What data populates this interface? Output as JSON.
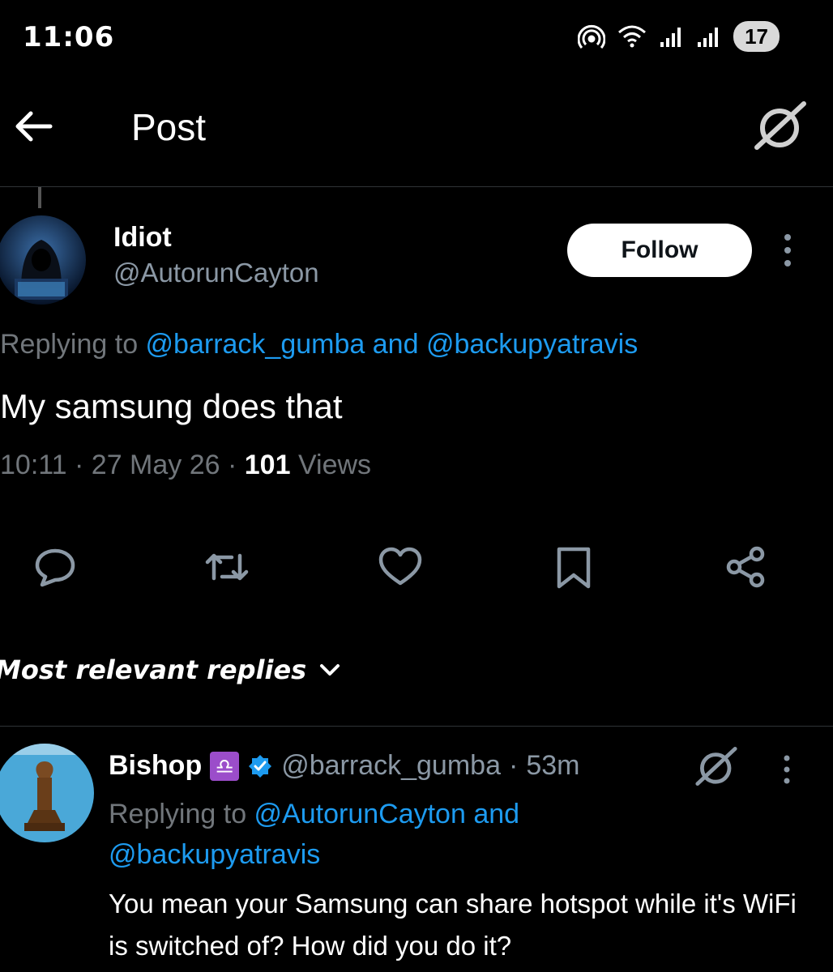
{
  "status_bar": {
    "time": "11:06",
    "battery": "17",
    "icons": [
      "hotspot-icon",
      "wifi-icon",
      "signal-icon",
      "signal-icon"
    ]
  },
  "header": {
    "title": "Post",
    "back_icon": "back-arrow-icon",
    "grok_icon": "grok-icon"
  },
  "post": {
    "author_name": "Idiot",
    "author_handle": "@AutorunCayton",
    "follow_label": "Follow",
    "replying_prefix": "Replying to ",
    "replying_mention_1": "@barrack_gumba",
    "replying_and": " and ",
    "replying_mention_2": "@backupyatravis",
    "text": "My samsung does that",
    "time": "10:11",
    "date": "27 May 26",
    "views_count": "101",
    "views_label": "Views",
    "separator": " · "
  },
  "actions": [
    "reply-icon",
    "repost-icon",
    "like-icon",
    "bookmark-icon",
    "share-icon"
  ],
  "replies": {
    "sort_label": "Most relevant replies"
  },
  "reply": {
    "name": "Bishop",
    "emoji": "♎",
    "handle": "@barrack_gumba",
    "separator": "·",
    "time": "53m",
    "replying_prefix": "Replying to ",
    "replying_mention_1": "@AutorunCayton",
    "replying_and": " and",
    "replying_mention_2": "@backupyatravis",
    "text": "You mean your Samsung can share hotspot while it's WiFi is switched of? How did you do it?"
  },
  "colors": {
    "background": "#000000",
    "accent": "#1d9bf0",
    "muted": "#71767b",
    "verified": "#1d9bf0"
  }
}
